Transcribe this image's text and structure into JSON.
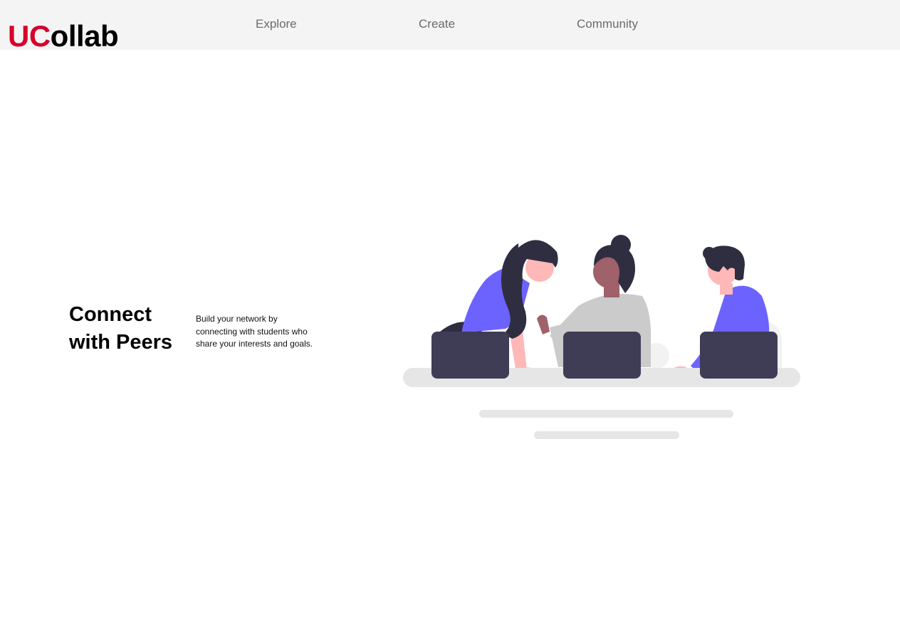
{
  "header": {
    "logo": {
      "accent": "UC",
      "rest": "ollab",
      "accent_color": "#d5002b"
    },
    "nav": [
      {
        "label": "Explore"
      },
      {
        "label": "Create"
      },
      {
        "label": "Community"
      }
    ]
  },
  "hero": {
    "title": "Connect with Peers",
    "description": "Build your network by connecting with students who share your interests and goals."
  },
  "illustration": {
    "icon": "people-collaborating-illustration",
    "colors": {
      "accent": "#6c63ff",
      "dark": "#2f2e41",
      "laptop": "#3f3d56",
      "skin": "#ffb8b8",
      "desk": "#e6e6e6"
    }
  }
}
